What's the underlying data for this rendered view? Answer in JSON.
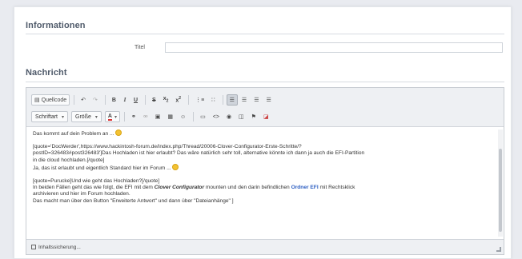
{
  "sections": {
    "informationen": "Informationen",
    "nachricht": "Nachricht"
  },
  "title_field": {
    "label": "Titel",
    "value": ""
  },
  "toolbar": {
    "source_label": "Quellcode",
    "font_label": "Schriftart",
    "size_label": "Größe",
    "color_label": "A"
  },
  "content": {
    "line1": "Das kommt auf dein Problem an ...",
    "quote1_a": "[quote='DocWerder',https://www.hackintosh-forum.de/index.php/Thread/20006-Clover-Configurator-Erste-Schritte/?",
    "quote1_b": "postID=326483#post326483']Das Hochladen ist hier erlaubt? Das wäre natürlich sehr toll, alternative könnte ich dann ja auch die EFI-Partition",
    "quote1_c": "in die cloud hochladen.[/quote]",
    "line2": "Ja, das ist erlaubt und eigentlich Standard hier im Forum ...",
    "quote2": "[quote=Purucke]Und wie geht das Hochladen?[/quote]",
    "line3_a": "In beiden Fällen geht das wie folgt, die EFI mit dem",
    "line3_cfg": "Clover Configurator",
    "line3_b": "mounten und den darin befindlichen",
    "line3_link": "Ordner EFI",
    "line3_c": "mit Rechtsklick",
    "line4": "archivieren und hier im Forum hochladen.",
    "line5": "Das macht man über den Button \"Erweiterte Antwort\" und dann über \"Dateianhänge\" ]"
  },
  "footer": {
    "label": "Inhaltssicherung..."
  },
  "colors": {
    "accent": "#2e5fc2",
    "section_title": "#4f5a6a"
  }
}
